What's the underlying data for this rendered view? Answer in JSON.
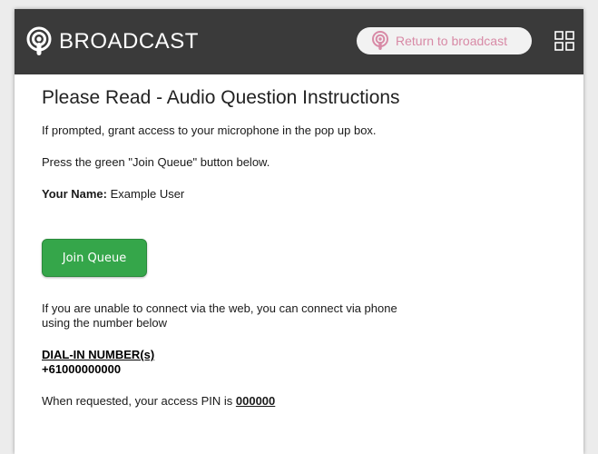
{
  "header": {
    "brand_title": "BROADCAST",
    "return_label": "Return to broadcast",
    "bg_color": "#3a3a3a",
    "return_color": "#d88aa6",
    "icons": {
      "brand": "podcast-icon",
      "return": "podcast-icon",
      "fullscreen": "fullscreen-icon"
    }
  },
  "content": {
    "title": "Please Read - Audio Question Instructions",
    "instruction1": "If prompted, grant access to your microphone in the pop up box.",
    "instruction2": "Press the green \"Join Queue\" button below.",
    "name_label": "Your Name:",
    "name_value": "Example User",
    "join_button": "Join Queue",
    "join_color": "#35a64a",
    "phone_info": "If you are unable to connect via the web, you can connect via phone using the number below",
    "dial_heading": "DIAL-IN NUMBER(s)",
    "dial_number": "+61000000000",
    "pin_text": "When requested, your access PIN is",
    "pin_value": "000000"
  }
}
